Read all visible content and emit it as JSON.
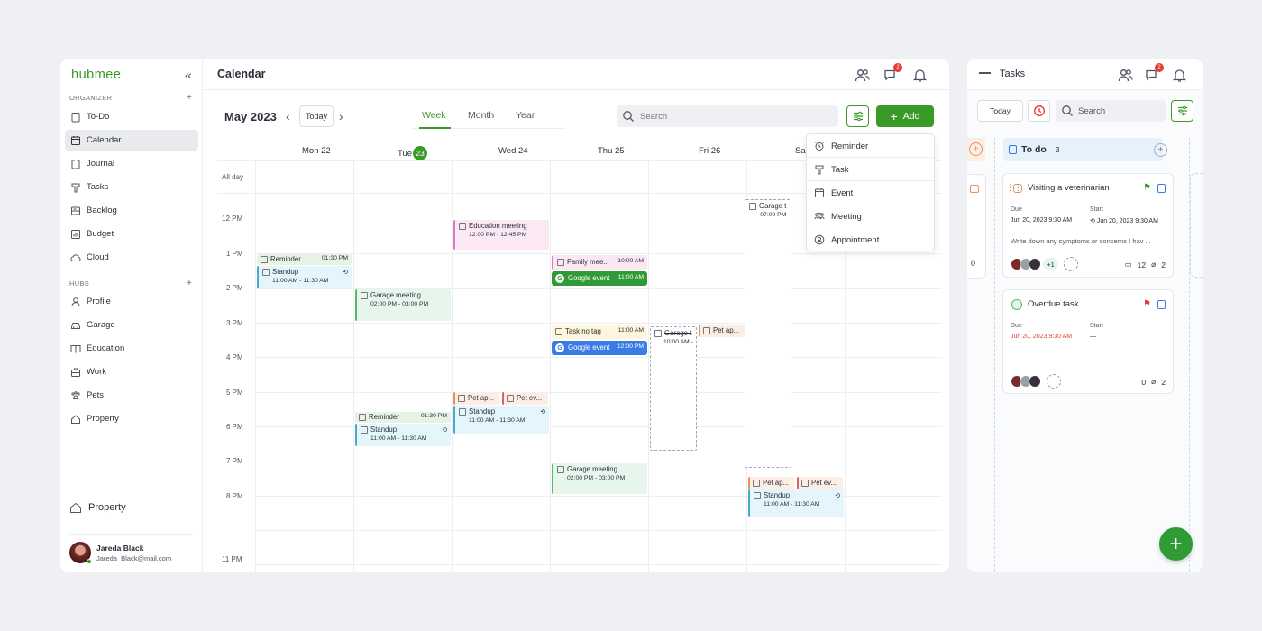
{
  "app": {
    "logo": "hubmee",
    "collapse": "«"
  },
  "sidebar": {
    "organizer_title": "ORGANIZER",
    "organizer_items": [
      {
        "label": "To-Do",
        "icon": "todo-icon"
      },
      {
        "label": "Calendar",
        "icon": "calendar-icon",
        "active": true
      },
      {
        "label": "Journal",
        "icon": "journal-icon"
      },
      {
        "label": "Tasks",
        "icon": "tasks-icon"
      },
      {
        "label": "Backlog",
        "icon": "backlog-icon"
      },
      {
        "label": "Budget",
        "icon": "budget-icon"
      },
      {
        "label": "Cloud",
        "icon": "cloud-icon"
      }
    ],
    "hubs_title": "HUBS",
    "hubs_items": [
      {
        "label": "Profile",
        "icon": "profile-icon"
      },
      {
        "label": "Garage",
        "icon": "car-icon"
      },
      {
        "label": "Education",
        "icon": "book-icon"
      },
      {
        "label": "Work",
        "icon": "briefcase-icon"
      },
      {
        "label": "Pets",
        "icon": "paw-icon"
      },
      {
        "label": "Property",
        "icon": "house-icon"
      }
    ],
    "bottom_hub": "Property",
    "user": {
      "name": "Jareda Black",
      "email": "Jareda_Black@mail.com"
    }
  },
  "calendar": {
    "title": "Calendar",
    "chat_badge": "2",
    "month": "May 2023",
    "today_label": "Today",
    "views": [
      "Week",
      "Month",
      "Year"
    ],
    "active_view": "Week",
    "search_placeholder": "Search",
    "add_label": "Add",
    "days": [
      "Mon 22",
      "Tue",
      "Wed 24",
      "Thu 25",
      "Fri 26",
      "Sa"
    ],
    "today_num": "23",
    "all_day": "All day",
    "hours": [
      "12 PM",
      "1 PM",
      "2 PM",
      "3 PM",
      "4 PM",
      "5 PM",
      "6 PM",
      "7 PM",
      "8 PM",
      "11 PM"
    ],
    "events": {
      "edu": {
        "title": "Education meeting",
        "time": "12:00 PM - 12:45 PM"
      },
      "mon_reminder": {
        "title": "Reminder",
        "time": "01:30 PM"
      },
      "mon_standup": {
        "title": "Standup",
        "time": "11:00 AM - 11:30 AM"
      },
      "family": {
        "title": "Family mee...",
        "time": "10:00 AM"
      },
      "google1": {
        "title": "Google event",
        "time": "11:00 AM"
      },
      "tue_garage": {
        "title": "Garage meeting",
        "time": "02:00 PM - 03:00 PM"
      },
      "task_no_tag": {
        "title": "Task no tag",
        "time": "11:00 AM"
      },
      "google2": {
        "title": "Google event",
        "time": "12:00 PM"
      },
      "fri_garage": {
        "title": "Garage t",
        "time": "10:00 AM -"
      },
      "fri_pet": {
        "title": "Pet ap..."
      },
      "sat_garage": {
        "title": "Garage t",
        "time": "-07:00 PM"
      },
      "wed_pet_ap": {
        "title": "Pet ap..."
      },
      "wed_pet_ev": {
        "title": "Pet ev..."
      },
      "wed_standup": {
        "title": "Standup",
        "time": "11:00 AM - 11:30 AM"
      },
      "tue_reminder": {
        "title": "Reminder",
        "time": "01:30 PM"
      },
      "tue_standup": {
        "title": "Standup",
        "time": "11:00 AM - 11:30 AM"
      },
      "thu_garage": {
        "title": "Garage meeting",
        "time": "02:00 PM - 03:00 PM"
      },
      "sat_pet_ap": {
        "title": "Pet ap..."
      },
      "sat_pet_ev": {
        "title": "Pet ev..."
      },
      "sat_standup": {
        "title": "Standup",
        "time": "11:00 AM - 11:30 AM"
      }
    },
    "dropdown": [
      "Reminder",
      "Task",
      "Event",
      "Meeting",
      "Appointment"
    ]
  },
  "tasks": {
    "title": "Tasks",
    "chat_badge": "2",
    "today_label": "Today",
    "search_placeholder": "Search",
    "column": {
      "label": "To do",
      "count": "3"
    },
    "left_stat": "0",
    "cards": [
      {
        "title": "Visiting a veterinarian",
        "due_label": "Due",
        "due": "Jun 20, 2023 9:30 AM",
        "start_label": "Start",
        "start": "Jun 20, 2023 9:30 AM",
        "desc": "Write down any symptoms or concerns I hav ...",
        "extra": "+1",
        "comments": "12",
        "attachments": "2"
      },
      {
        "title": "Overdue task",
        "due_label": "Due",
        "due": "Jun 20, 2023 9:30 AM",
        "start_label": "Start",
        "start": "—",
        "comments": "0",
        "attachments": "2"
      }
    ]
  },
  "colors": {
    "accent": "#3a9a28",
    "danger": "#e53935",
    "google_blue": "#3a7be6"
  }
}
